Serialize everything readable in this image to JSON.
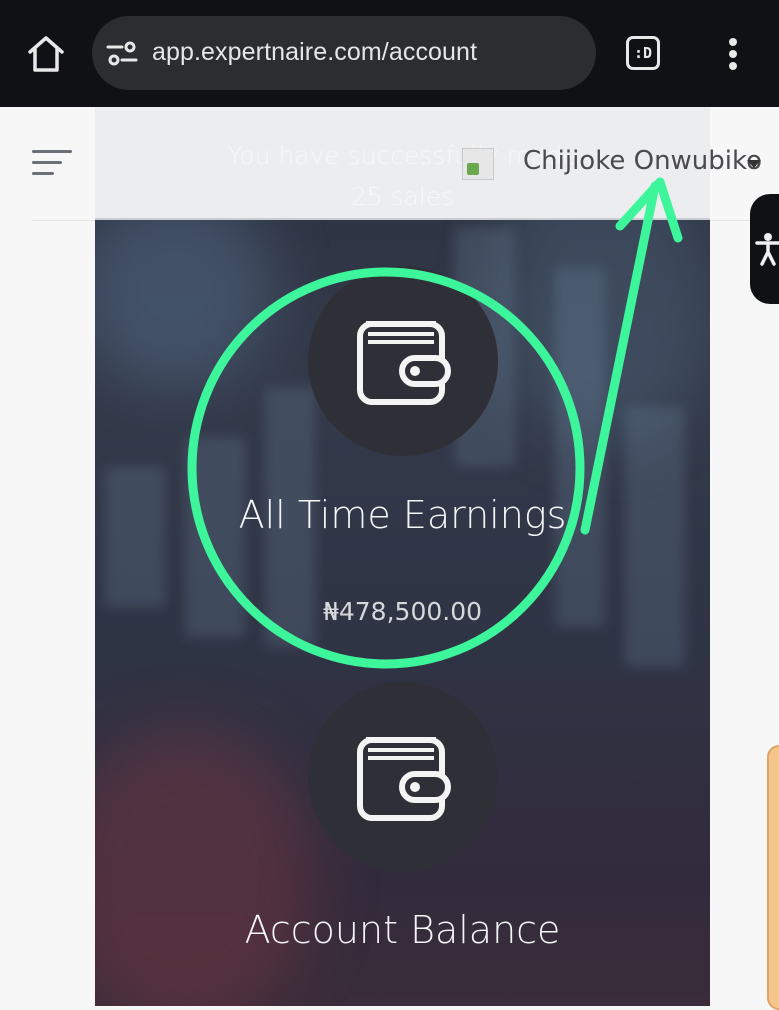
{
  "browser": {
    "url": "app.expertnaire.com/account",
    "extension_badge": ":D",
    "icons": [
      "home-icon",
      "site-info-icon",
      "extension-icon",
      "more-vert-icon"
    ]
  },
  "header": {
    "toast_line1": "You have successfully made",
    "toast_line2": "25 sales",
    "user_name": "Chijioke Onwubiko"
  },
  "cards": [
    {
      "title": "All Time Earnings",
      "value": "₦478,500.00",
      "icon": "wallet-icon"
    },
    {
      "title": "Account Balance",
      "icon": "wallet-icon"
    }
  ],
  "colors": {
    "annotation": "#3df59a",
    "panel_bg": "#2f3445",
    "browser_bar": "#0f1114"
  }
}
